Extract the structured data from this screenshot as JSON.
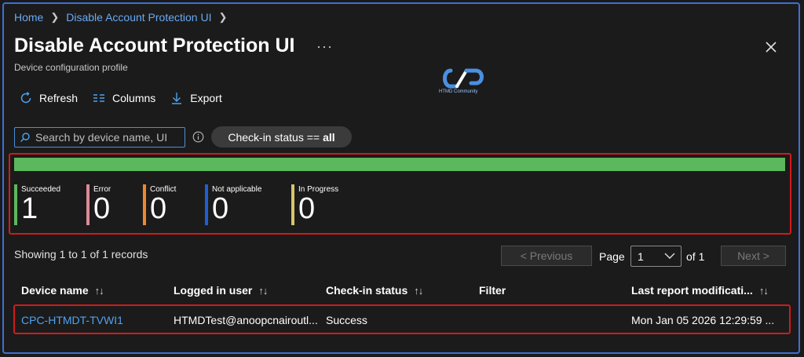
{
  "breadcrumb": {
    "home": "Home",
    "current": "Disable Account Protection UI"
  },
  "header": {
    "title": "Disable Account Protection UI",
    "more": "···",
    "subtitle": "Device configuration profile"
  },
  "logo": {
    "text": "HTMD Community"
  },
  "toolbar": {
    "refresh": "Refresh",
    "columns": "Columns",
    "export": "Export"
  },
  "search": {
    "placeholder": "Search by device name, UI",
    "value": ""
  },
  "filter": {
    "label": "Check-in status ==",
    "value": "all"
  },
  "status": {
    "bar_color": "#5cb85c",
    "items": [
      {
        "label": "Succeeded",
        "value": "1",
        "color": "#5cb85c"
      },
      {
        "label": "Error",
        "value": "0",
        "color": "#d98c95"
      },
      {
        "label": "Conflict",
        "value": "0",
        "color": "#f0872d"
      },
      {
        "label": "Not applicable",
        "value": "0",
        "color": "#1e5fd6"
      },
      {
        "label": "In Progress",
        "value": "0",
        "color": "#d9c56a"
      }
    ]
  },
  "records": {
    "text": "Showing 1 to 1 of 1 records"
  },
  "pagination": {
    "previous": "< Previous",
    "page_label": "Page",
    "page_value": "1",
    "of_label": "of 1",
    "next": "Next >"
  },
  "table": {
    "columns": [
      "Device name",
      "Logged in user",
      "Check-in status",
      "Filter",
      "Last report modificati..."
    ],
    "sort_glyph": "↑↓",
    "rows": [
      {
        "device": "CPC-HTMDT-TVWI1",
        "user": "HTMDTest@anoopcnairoutl...",
        "status": "Success",
        "filter": "",
        "last_report": "Mon Jan 05 2026 12:29:59 ..."
      }
    ]
  }
}
